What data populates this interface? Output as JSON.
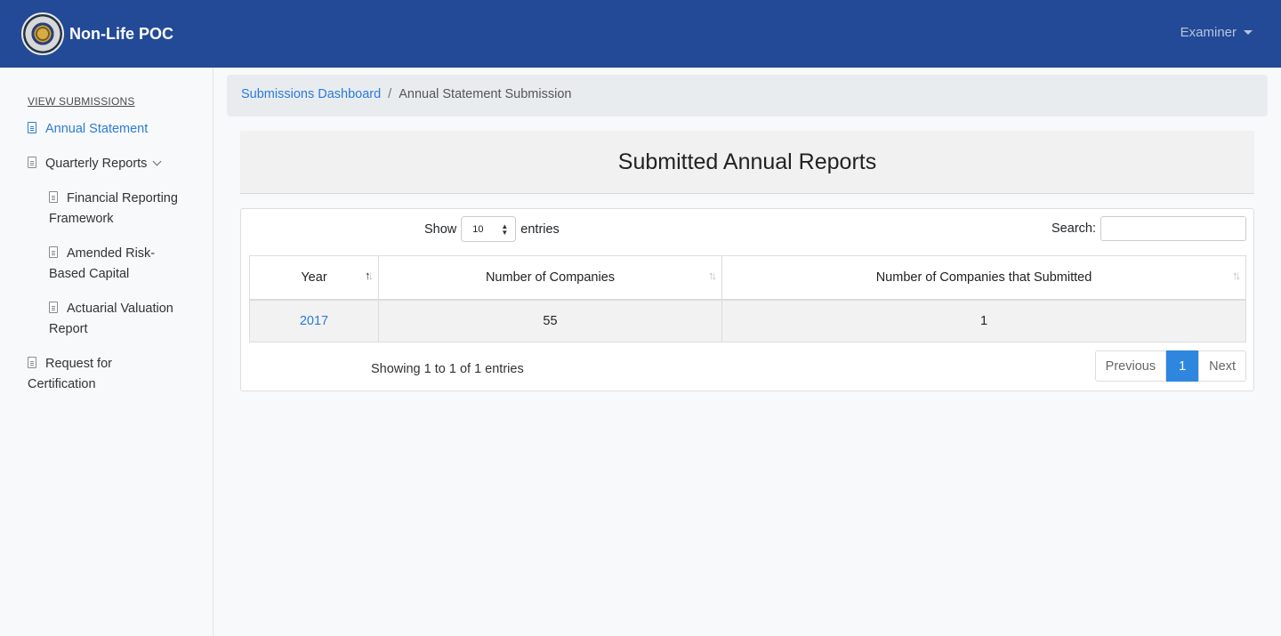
{
  "app": {
    "brand": "Non-Life POC",
    "user": "Examiner"
  },
  "sidebar": {
    "heading": "VIEW SUBMISSIONS",
    "items": [
      {
        "label": "Annual Statement",
        "icon": "document-icon",
        "active": true
      },
      {
        "label": "Quarterly Reports",
        "icon": "document-icon",
        "expandable": true
      },
      {
        "label": "Financial Reporting Framework",
        "icon": "document-icon"
      },
      {
        "label": "Amended Risk-Based Capital",
        "icon": "document-icon"
      },
      {
        "label": "Actuarial Valuation Report",
        "icon": "document-icon"
      },
      {
        "label": "Request for Certification",
        "icon": "document-icon"
      }
    ]
  },
  "breadcrumb": {
    "parent": "Submissions Dashboard",
    "separator": "/",
    "current": "Annual Statement Submission"
  },
  "page": {
    "title": "Submitted Annual Reports"
  },
  "table": {
    "show_label": "Show",
    "page_size": "10",
    "entries_label": "entries",
    "search_label": "Search:",
    "search_value": "",
    "columns": [
      "Year",
      "Number of Companies",
      "Number of Companies that Submitted"
    ],
    "rows": [
      {
        "year": "2017",
        "companies": "55",
        "submitted": "1"
      }
    ],
    "info": "Showing 1 to 1 of 1 entries",
    "pagination": {
      "previous": "Previous",
      "current": "1",
      "next": "Next"
    }
  },
  "colors": {
    "navbar": "#224a96",
    "link": "#2a7bd8",
    "active_page": "#2f86df"
  }
}
